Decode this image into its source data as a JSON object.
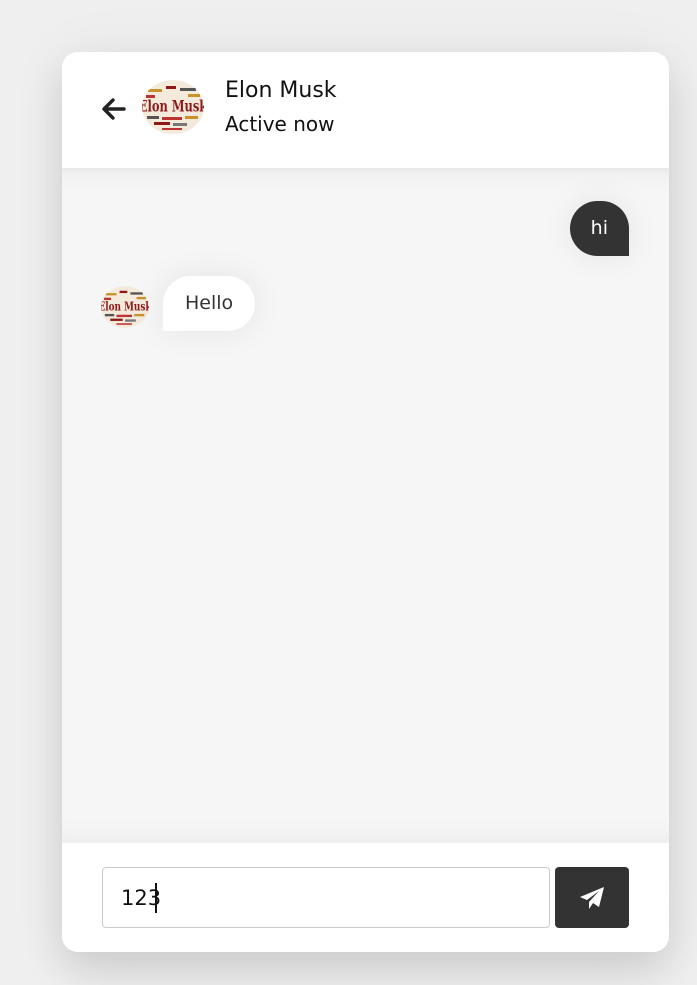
{
  "header": {
    "contact_name": "Elon Musk",
    "status": "Active now",
    "back_icon": "arrow-left-icon",
    "avatar_text": "Elon Musk"
  },
  "messages": [
    {
      "direction": "outgoing",
      "text": "hi"
    },
    {
      "direction": "incoming",
      "text": "Hello"
    }
  ],
  "composer": {
    "value": "123",
    "send_icon": "paper-plane-icon"
  },
  "colors": {
    "page_bg": "#efefef",
    "card_bg": "#ffffff",
    "chat_bg": "#f6f6f6",
    "dark": "#333333",
    "input_border": "#cccccc"
  }
}
